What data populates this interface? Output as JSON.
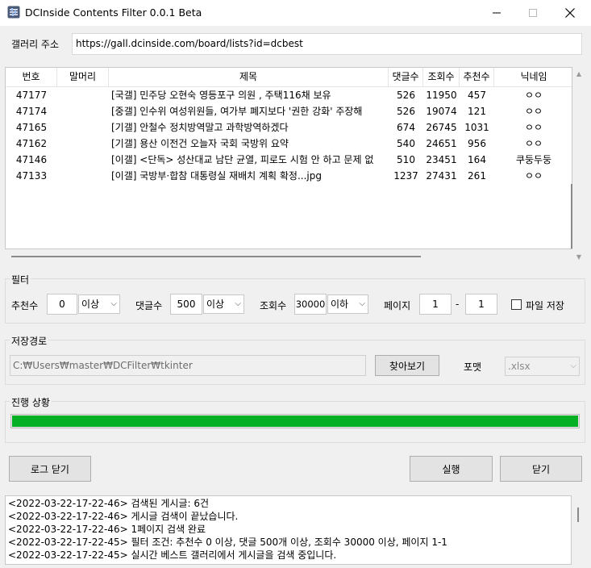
{
  "window": {
    "title": "DCInside Contents Filter 0.0.1 Beta",
    "icon": "app-filter-icon"
  },
  "address": {
    "label": "갤러리 주소",
    "value": "https://gall.dcinside.com/board/lists?id=dcbest"
  },
  "table": {
    "columns": [
      "번호",
      "말머리",
      "제목",
      "댓글수",
      "조회수",
      "추천수",
      "닉네임"
    ],
    "rows": [
      {
        "no": "47177",
        "head": "",
        "title": "[국갤] 민주당 오현숙 영등포구 의원 , 주택116채 보유",
        "comments": "526",
        "views": "11950",
        "recommends": "457",
        "nick": "ㅇㅇ"
      },
      {
        "no": "47174",
        "head": "",
        "title": "[중갤] 인수위 여성위원들, 여가부 폐지보다 '권한 강화' 주장해",
        "comments": "526",
        "views": "19074",
        "recommends": "121",
        "nick": "ㅇㅇ"
      },
      {
        "no": "47165",
        "head": "",
        "title": "[기갤] 안철수 정치방역말고 과학방역하겠다",
        "comments": "674",
        "views": "26745",
        "recommends": "1031",
        "nick": "ㅇㅇ"
      },
      {
        "no": "47162",
        "head": "",
        "title": "[기갤] 용산 이전건 오늘자 국회 국방위 요약",
        "comments": "540",
        "views": "24651",
        "recommends": "956",
        "nick": "ㅇㅇ"
      },
      {
        "no": "47146",
        "head": "",
        "title": "[이갤] <단독> 성산대교 남단 균열, 피로도 시험 안 하고 문제 없",
        "comments": "510",
        "views": "23451",
        "recommends": "164",
        "nick": "쿠둥두둥"
      },
      {
        "no": "47133",
        "head": "",
        "title": "[이갤] 국방부·합참 대통령실 재배치 계획 확정...jpg",
        "comments": "1237",
        "views": "27431",
        "recommends": "261",
        "nick": "ㅇㅇ"
      }
    ]
  },
  "filter": {
    "group_label": "필터",
    "recommend_label": "추천수",
    "recommend_value": "0",
    "recommend_cond": "이상",
    "comment_label": "댓글수",
    "comment_value": "500",
    "comment_cond": "이상",
    "view_label": "조회수",
    "view_value": "30000",
    "view_cond": "이하",
    "page_label": "페이지",
    "page_from": "1",
    "page_sep": "-",
    "page_to": "1",
    "file_save_label": "파일 저장",
    "file_save_checked": false
  },
  "save": {
    "group_label": "저장경로",
    "path": "C:₩Users₩master₩DCFilter₩tkinter",
    "browse_label": "찾아보기",
    "format_label": "포맷",
    "format_value": ".xlsx"
  },
  "progress": {
    "group_label": "진행 상황",
    "percent": 100,
    "color": "#06b025"
  },
  "buttons": {
    "close_log": "로그 닫기",
    "run": "실행",
    "close": "닫기"
  },
  "log": [
    "<2022-03-22-17-22-46> 검색된 게시글: 6건",
    "<2022-03-22-17-22-46> 게시글 검색이 끝났습니다.",
    "<2022-03-22-17-22-46> 1페이지 검색 완료",
    "<2022-03-22-17-22-45> 필터 조건: 추천수 0 이상, 댓글 500개 이상, 조회수 30000 이상, 페이지 1-1",
    "<2022-03-22-17-22-45> 실시간 베스트 갤러리에서 게시글을 검색 중입니다."
  ]
}
